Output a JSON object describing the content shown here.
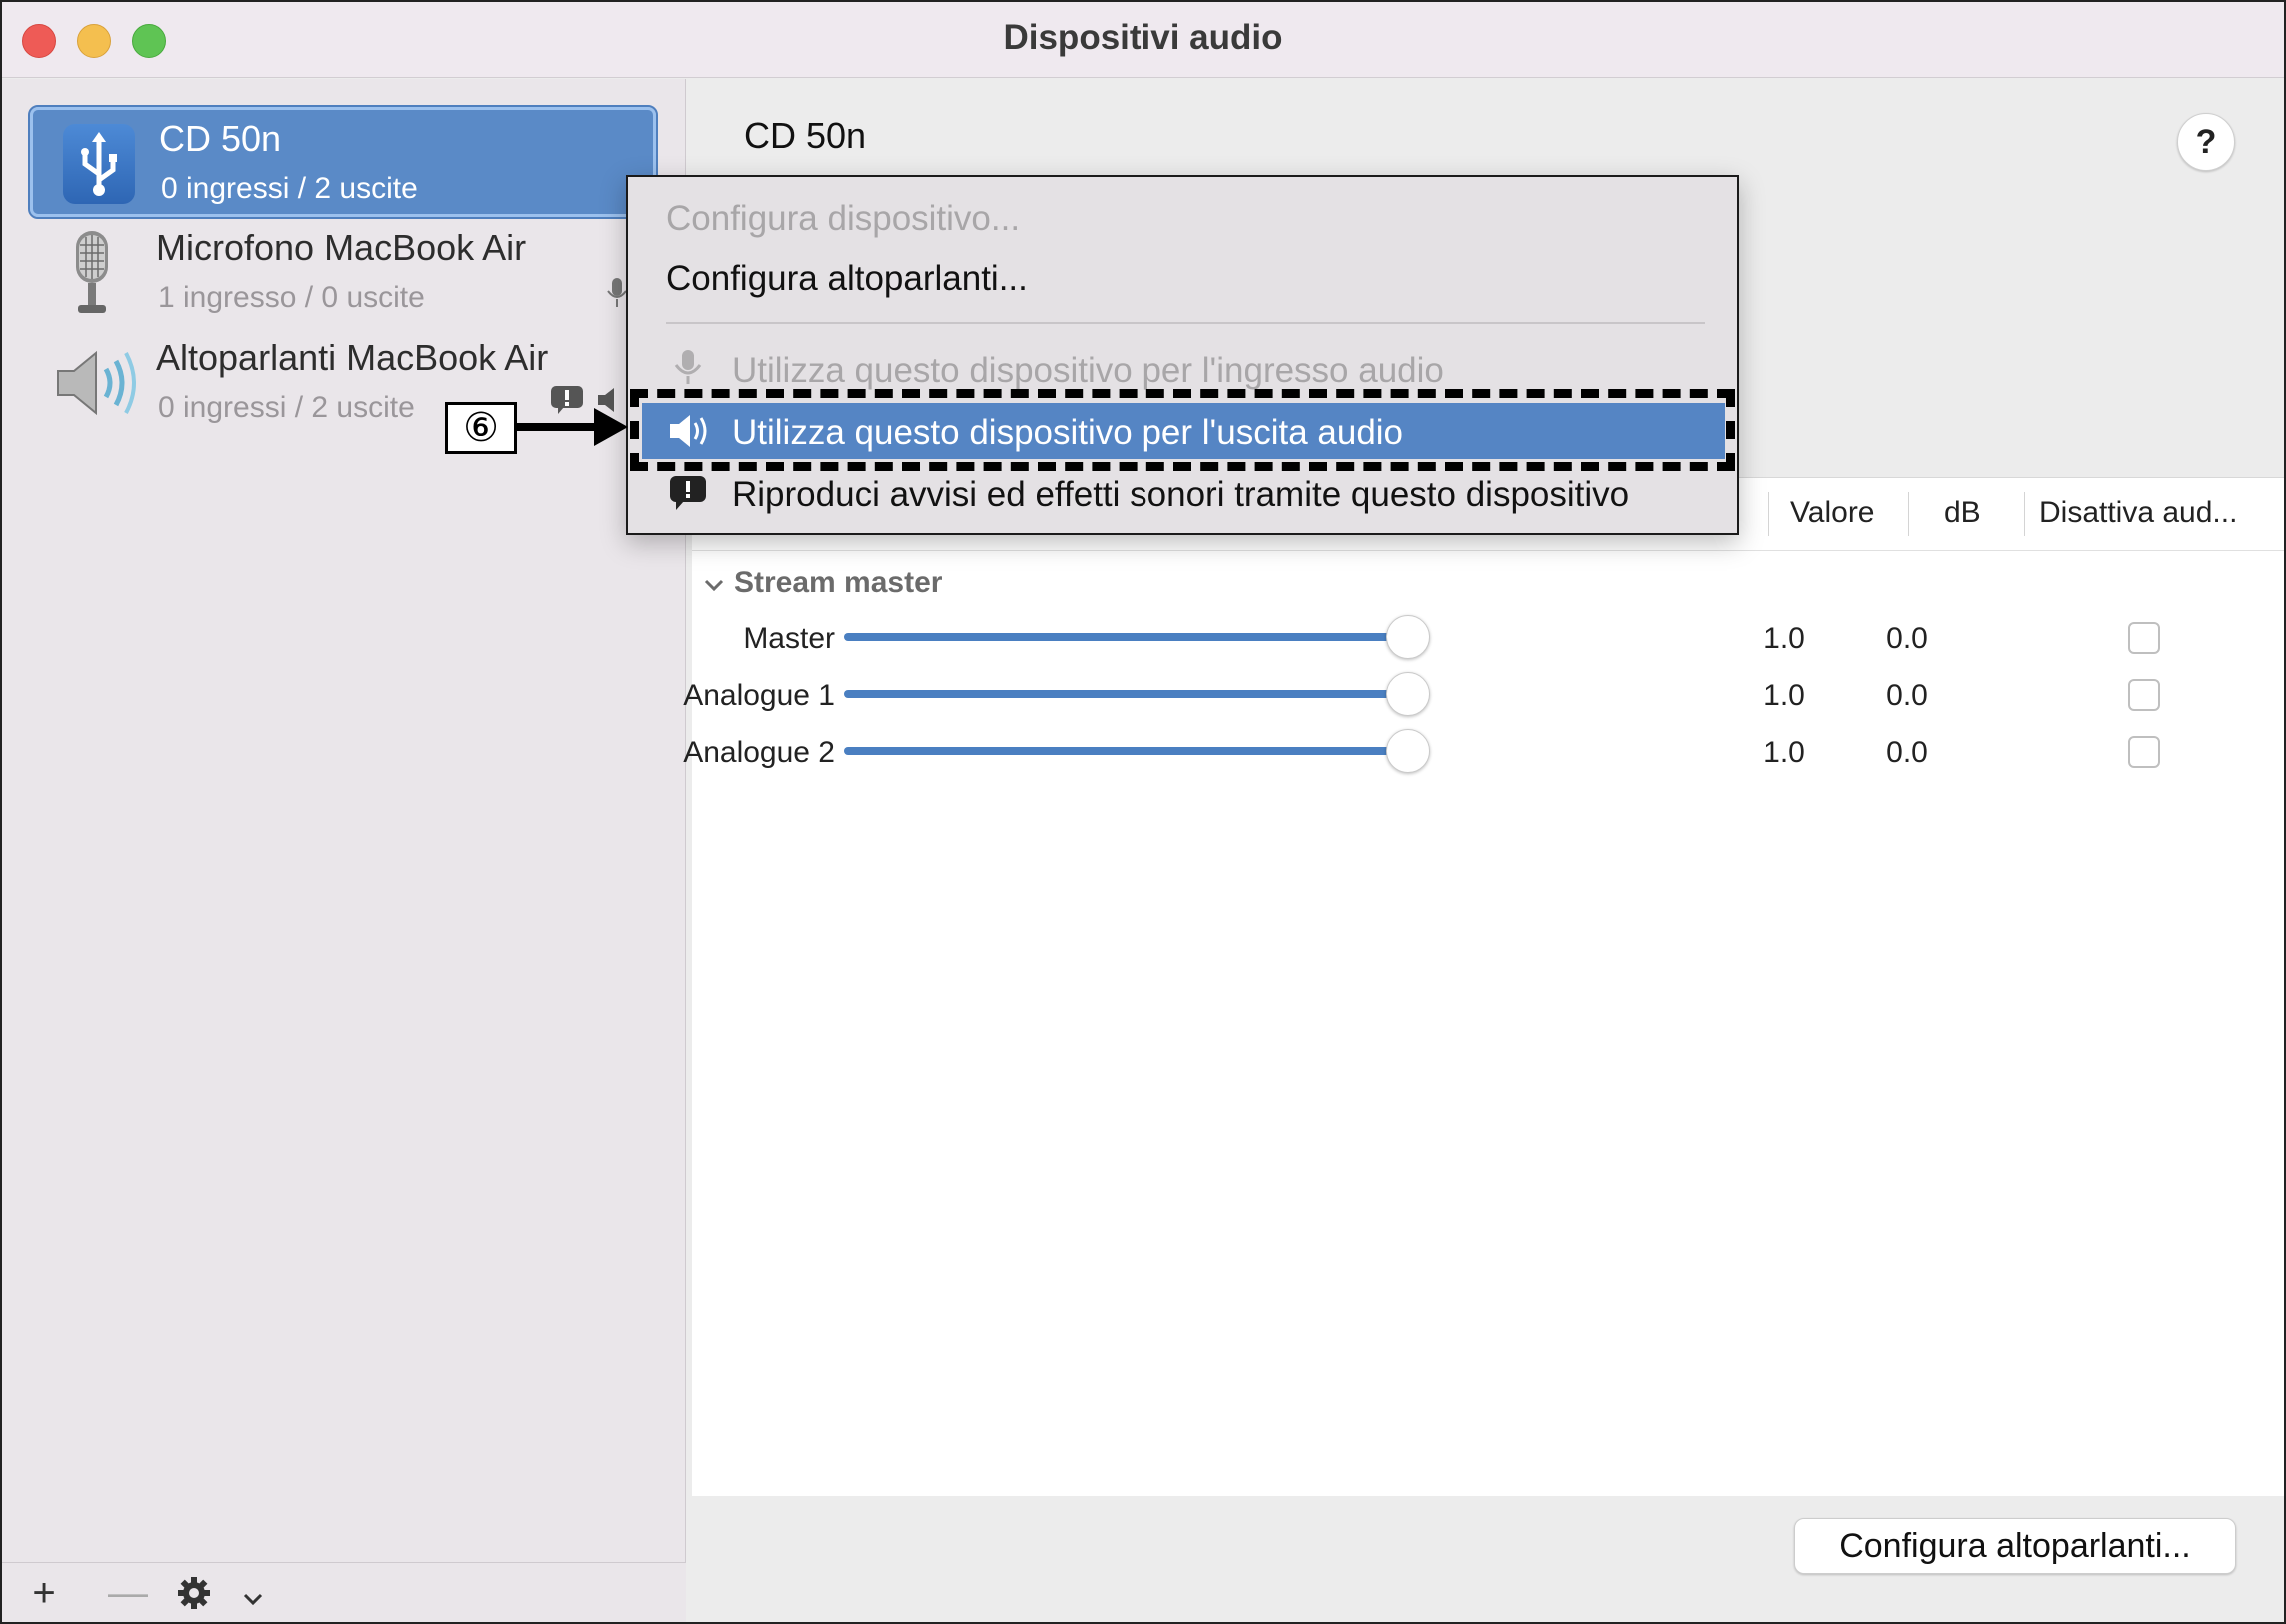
{
  "window": {
    "title": "Dispositivi audio"
  },
  "sidebar": {
    "devices": [
      {
        "name": "CD 50n",
        "io": "0 ingressi / 2 uscite",
        "icon": "usb-icon",
        "selected": true
      },
      {
        "name": "Microfono MacBook Air",
        "io": "1 ingresso / 0 uscite",
        "icon": "microphone-icon",
        "selected": false
      },
      {
        "name": "Altoparlanti MacBook Air",
        "io": "0 ingressi / 2 uscite",
        "icon": "speaker-icon",
        "selected": false
      }
    ],
    "footer": {
      "add": "+",
      "remove": "—"
    }
  },
  "main": {
    "device_title": "CD 50n",
    "help_label": "?",
    "columns": {
      "value": "Valore",
      "db": "dB",
      "mute": "Disattiva aud..."
    },
    "section": "Stream master",
    "rows": [
      {
        "label": "Master",
        "value": "1.0",
        "db": "0.0",
        "level": 1.0,
        "muted": false
      },
      {
        "label": "Analogue 1",
        "value": "1.0",
        "db": "0.0",
        "level": 1.0,
        "muted": false
      },
      {
        "label": "Analogue 2",
        "value": "1.0",
        "db": "0.0",
        "level": 1.0,
        "muted": false
      }
    ],
    "configure_button": "Configura altoparlanti..."
  },
  "context_menu": {
    "items": [
      {
        "label": "Configura dispositivo...",
        "enabled": false
      },
      {
        "label": "Configura altoparlanti...",
        "enabled": true
      },
      {
        "label": "Utilizza questo dispositivo per l'ingresso audio",
        "enabled": false,
        "icon": "microphone-icon"
      },
      {
        "label": "Utilizza questo dispositivo per l'uscita audio",
        "enabled": true,
        "highlighted": true,
        "icon": "speaker-icon"
      },
      {
        "label": "Riproduci avvisi ed effetti sonori tramite questo dispositivo",
        "enabled": true,
        "icon": "alert-icon"
      }
    ]
  },
  "annotation": {
    "step": "⑥"
  },
  "colors": {
    "accent": "#5585c4",
    "selected_row": "#5a8ac7",
    "slider": "#4a7fc1"
  }
}
